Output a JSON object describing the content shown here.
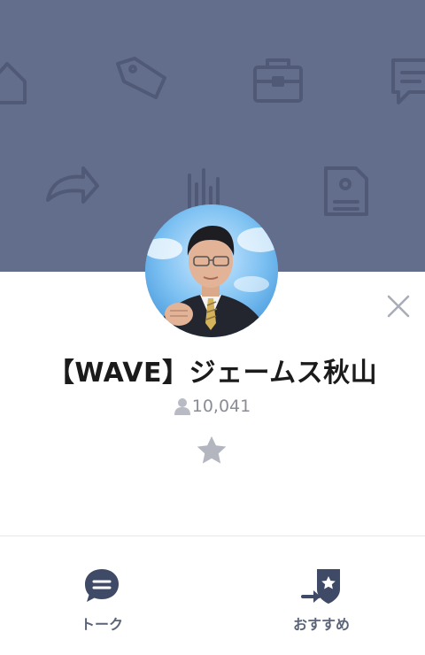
{
  "profile": {
    "name": "【WAVE】ジェームス秋山",
    "followers": "10,041"
  },
  "actions": {
    "close_icon": "close-icon",
    "favorite_icon": "star-icon"
  },
  "tabs": [
    {
      "label": "トーク",
      "icon": "chat-bubble-icon"
    },
    {
      "label": "おすすめ",
      "icon": "recommend-share-icon"
    }
  ],
  "colors": {
    "cover": "#636e8d",
    "pattern_icons": "#4f5874",
    "icon_dark": "#3f4a66",
    "muted": "#a9adb8"
  }
}
